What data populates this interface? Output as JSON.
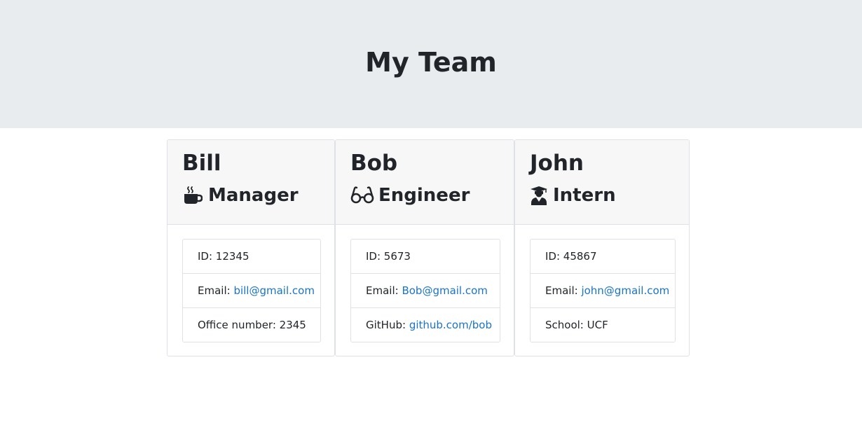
{
  "header": {
    "title": "My Team"
  },
  "employees": [
    {
      "name": "Bill",
      "role": "Manager",
      "role_icon": "coffee-icon",
      "id_label": "ID: 12345",
      "email_prefix": "Email: ",
      "email": "bill@gmail.com",
      "extra_prefix": "Office number: 2345",
      "extra_link": ""
    },
    {
      "name": "Bob",
      "role": "Engineer",
      "role_icon": "glasses-icon",
      "id_label": "ID: 5673",
      "email_prefix": "Email: ",
      "email": "Bob@gmail.com",
      "extra_prefix": "GitHub: ",
      "extra_link": "github.com/bob"
    },
    {
      "name": "John",
      "role": "Intern",
      "role_icon": "graduate-icon",
      "id_label": "ID: 45867",
      "email_prefix": "Email: ",
      "email": "john@gmail.com",
      "extra_prefix": "School: UCF",
      "extra_link": ""
    }
  ],
  "colors": {
    "header_bg": "#e9ecef",
    "card_header_bg": "#f7f7f7",
    "link": "#1a73c8",
    "text": "#212529"
  }
}
